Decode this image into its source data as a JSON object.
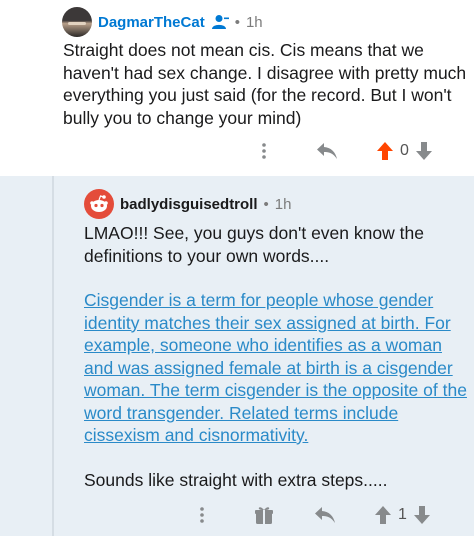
{
  "comment1": {
    "username": "DagmarTheCat",
    "age": "1h",
    "body": "Straight does not mean cis. Cis means that we haven't had sex change. I disagree with pretty much everything you just said (for the record. But I won't bully you to change your mind)",
    "score": "0"
  },
  "comment2": {
    "username": "badlydisguisedtroll",
    "age": "1h",
    "paragraph1": "LMAO!!! See, you guys don't even know the definitions to your own words....",
    "quote": "Cisgender is a term for people whose gender identity matches their sex assigned at birth. For example, someone who identifies as a woman and was assigned female at birth is a cisgender woman. The term cisgender is the opposite of the word transgender. Related terms include cissexism and cisnormativity.",
    "paragraph3": "Sounds like straight with extra steps.....",
    "score": "1"
  },
  "separator_dot": "•",
  "colors": {
    "upvoted": "#ff4500",
    "link": "#2a8ac8",
    "username": "#0079d3",
    "reply_bg": "#e8eff5"
  }
}
